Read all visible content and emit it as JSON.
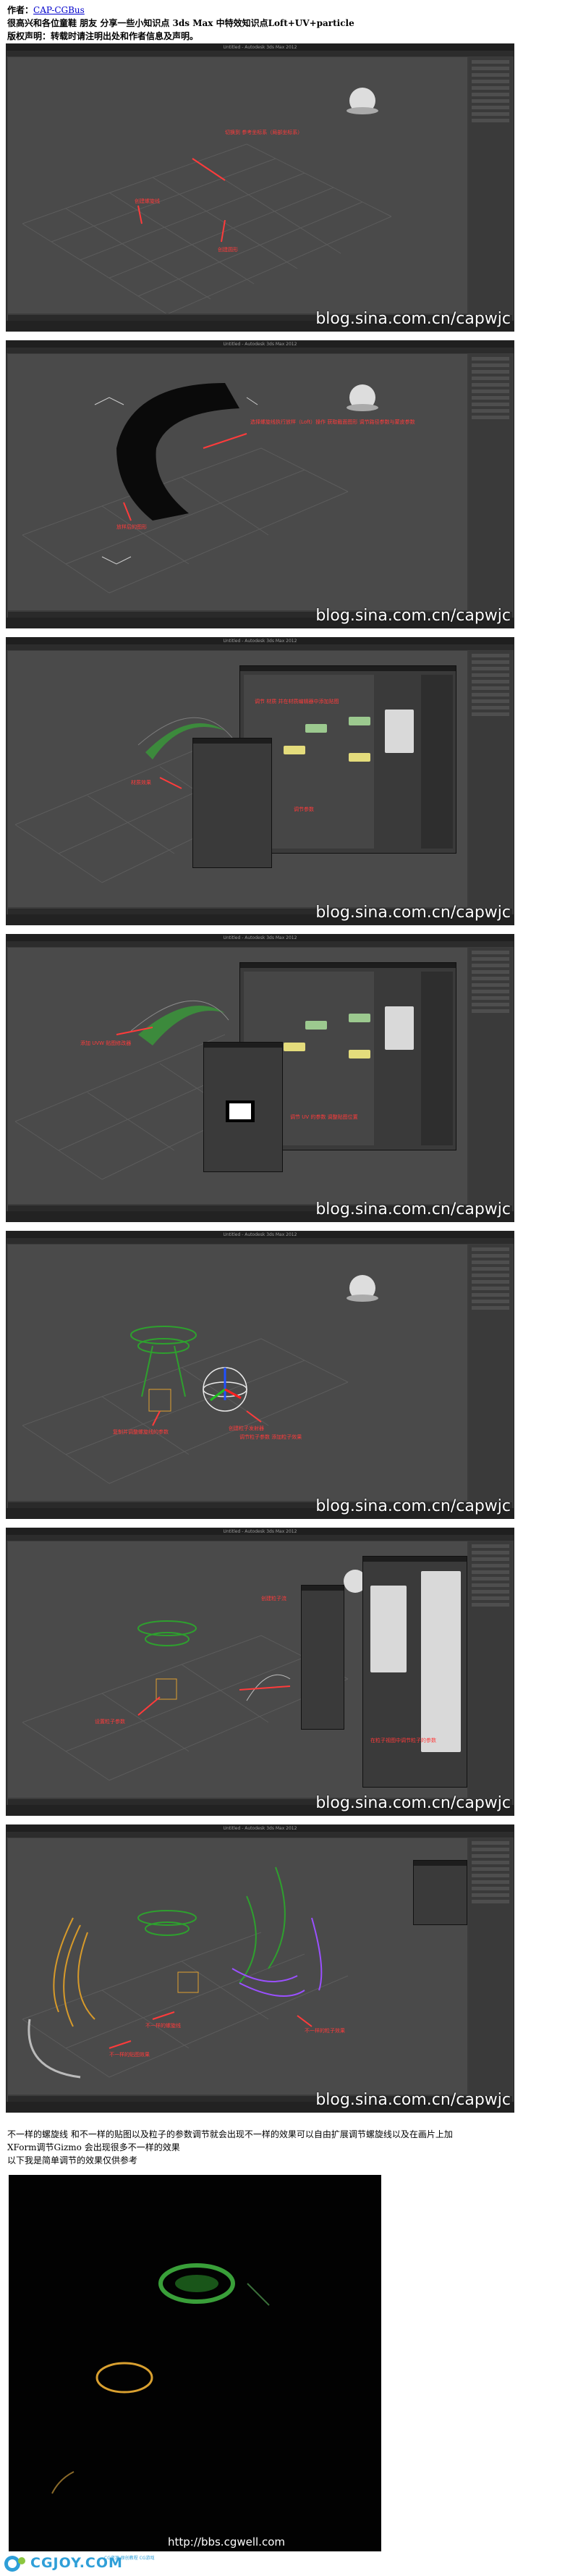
{
  "header": {
    "author_label": "作者：",
    "author_link": "CAP-CGBus",
    "line2": "很高兴和各位童鞋 朋友 分享一些小知识点 3ds Max 中特效知识点Loft+UV+particle",
    "line3": "版权声明：转载时请注明出处和作者信息及声明。"
  },
  "screenshots": [
    {
      "title": "Untitled - Autodesk 3ds Max 2012",
      "watermark": "blog.sina.com.cn/capwjc",
      "notes": [
        "切换到 参考坐标系（局部坐标系）",
        "创建螺旋线",
        "创建圆形"
      ]
    },
    {
      "title": "Untitled - Autodesk 3ds Max 2012",
      "watermark": "blog.sina.com.cn/capwjc",
      "notes": [
        "选择螺旋线执行放样（Loft）操作 获取截面图形 调节路径参数与蒙皮参数",
        "放样后的图形"
      ]
    },
    {
      "title": "Untitled - Autodesk 3ds Max 2012",
      "watermark": "blog.sina.com.cn/capwjc",
      "notes": [
        "调节 材质 并在材质编辑器中添加贴图",
        "材质效果",
        "调节参数"
      ]
    },
    {
      "title": "Untitled - Autodesk 3ds Max 2012",
      "watermark": "blog.sina.com.cn/capwjc",
      "notes": [
        "添加 UVW 贴图修改器",
        "调节 UV 的参数 调整贴图位置"
      ]
    },
    {
      "title": "Untitled - Autodesk 3ds Max 2012",
      "watermark": "blog.sina.com.cn/capwjc",
      "notes": [
        "复制并调整螺旋线的参数",
        "创建粒子发射器",
        "调节粒子参数 添加粒子效果"
      ]
    },
    {
      "title": "Untitled - Autodesk 3ds Max 2012",
      "watermark": "blog.sina.com.cn/capwjc",
      "notes": [
        "创建粒子流",
        "设置粒子参数",
        "在粒子视图中调节粒子的参数"
      ]
    },
    {
      "title": "Untitled - Autodesk 3ds Max 2012",
      "watermark": "blog.sina.com.cn/capwjc",
      "notes": [
        "不一样的螺旋线",
        "不一样的贴图效果",
        "不一样的粒子效果"
      ]
    }
  ],
  "paragraph": {
    "line1": "不一样的螺旋线 和不一样的贴图以及粒子的参数调节就会出现不一样的效果可以自由扩展调节螺旋线以及在画片上加",
    "line2": "XForm调节Gizmo 会出现很多不一样的效果",
    "line3": "以下我是简单调节的效果仅供参考"
  },
  "render": {
    "watermark": "http://bbs.cgwell.com"
  },
  "logo": {
    "text": "CGJOY.COM",
    "sub": "CG资源 原创教程 CG游戏"
  },
  "colors": {
    "annotation": "#ff3b3b",
    "viewport": "#4a4a4a",
    "link": "#0000cc",
    "logo": "#2f9fd8"
  }
}
